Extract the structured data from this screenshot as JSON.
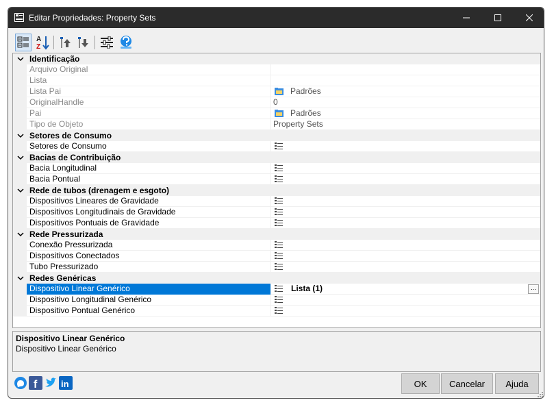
{
  "window": {
    "title": "Editar Propriedades: Property Sets",
    "controls": {
      "minimize": "─",
      "maximize": "☐",
      "close": "✕"
    }
  },
  "toolbar": {
    "items": [
      {
        "name": "categorized-view",
        "icon": "categorized-icon"
      },
      {
        "name": "alphabetical-sort",
        "icon": "az-sort-icon"
      },
      {
        "name": "move-up",
        "icon": "move-up-icon"
      },
      {
        "name": "move-down",
        "icon": "move-down-icon"
      },
      {
        "name": "settings",
        "icon": "sliders-icon"
      },
      {
        "name": "help",
        "icon": "help-globe-icon"
      }
    ]
  },
  "grid": {
    "categories": [
      {
        "label": "Identificação"
      },
      {
        "label": "Setores de Consumo"
      },
      {
        "label": "Bacias de Contribuição"
      },
      {
        "label": "Rede de tubos (drenagem e esgoto)"
      },
      {
        "label": "Rede Pressurizada"
      },
      {
        "label": "Redes Genéricas"
      }
    ],
    "identificacao": {
      "arquivo_original": {
        "name": "Arquivo Original",
        "value": ""
      },
      "lista": {
        "name": "Lista",
        "value": ""
      },
      "lista_pai": {
        "name": "Lista Pai",
        "value": "Padrões"
      },
      "original_handle": {
        "name": "OriginalHandle",
        "value": "0"
      },
      "pai": {
        "name": "Pai",
        "value": "Padrões"
      },
      "tipo_objeto": {
        "name": "Tipo de Objeto",
        "value": "Property Sets"
      }
    },
    "setores": [
      {
        "name": "Setores de Consumo"
      }
    ],
    "bacias": [
      {
        "name": "Bacia Longitudinal"
      },
      {
        "name": "Bacia Pontual"
      }
    ],
    "rede_tubos": [
      {
        "name": "Dispositivos Lineares de Gravidade"
      },
      {
        "name": "Dispositivos Longitudinais de Gravidade"
      },
      {
        "name": "Dispositivos Pontuais de Gravidade"
      }
    ],
    "rede_pressurizada": [
      {
        "name": "Conexão Pressurizada"
      },
      {
        "name": "Dispositivos Conectados"
      },
      {
        "name": "Tubo Pressurizado"
      }
    ],
    "redes_genericas": [
      {
        "name": "Dispositivo Linear Genérico",
        "value": "Lista (1)",
        "button": "..."
      },
      {
        "name": "Dispositivo Longitudinal Genérico"
      },
      {
        "name": "Dispositivo Pontual Genérico"
      }
    ]
  },
  "description": {
    "title": "Dispositivo Linear Genérico",
    "text": "Dispositivo Linear Genérico"
  },
  "social": [
    {
      "name": "chat",
      "icon": "chat-bubble-icon"
    },
    {
      "name": "facebook",
      "icon": "facebook-icon"
    },
    {
      "name": "twitter",
      "icon": "twitter-icon"
    },
    {
      "name": "linkedin",
      "icon": "linkedin-icon"
    }
  ],
  "buttons": {
    "ok": "OK",
    "cancel": "Cancelar",
    "help": "Ajuda"
  },
  "colors": {
    "selection": "#0078d7",
    "titlebar": "#2b2b2b",
    "category_bg": "#f0f0f0"
  }
}
